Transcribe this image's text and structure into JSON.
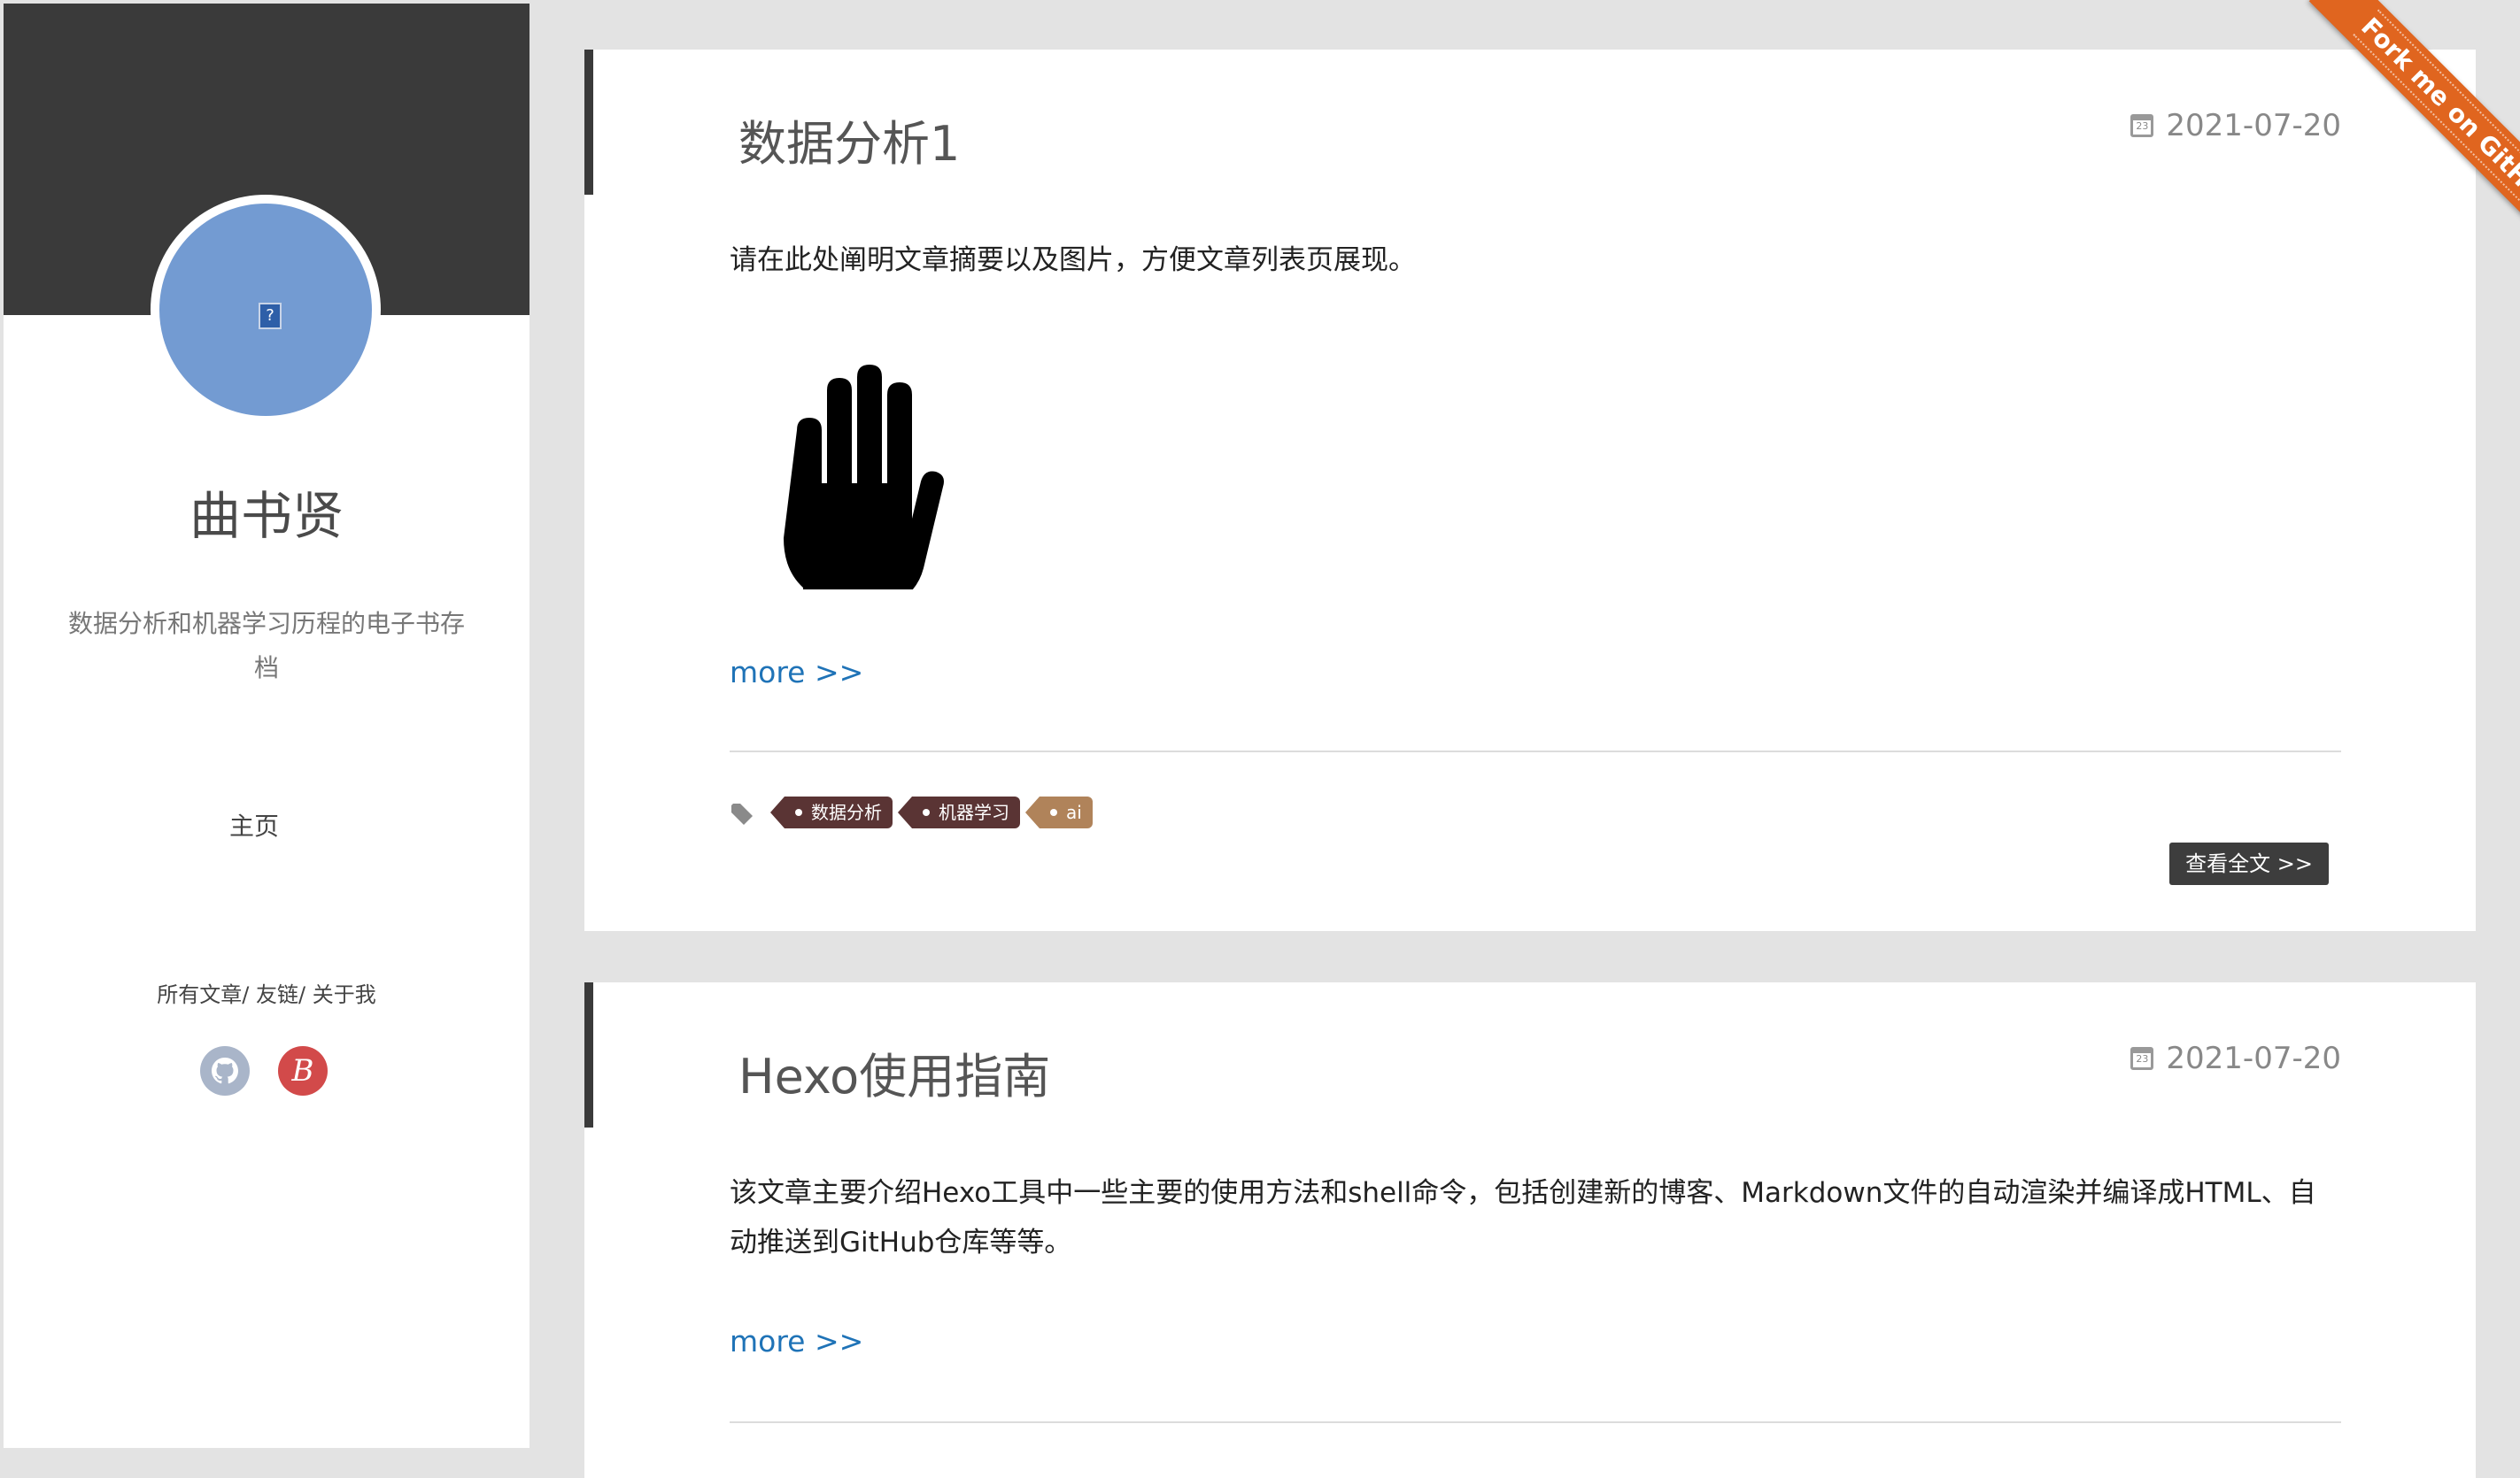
{
  "sidebar": {
    "author_name": "曲书贤",
    "description": "数据分析和机器学习历程的电子书存档",
    "nav_home": "主页",
    "links": [
      "所有文章",
      "友链",
      "关于我"
    ],
    "link_separator": "/",
    "blog_icon_letter": "B",
    "broken_image_glyph": "?"
  },
  "ribbon": {
    "label": "Fork me on GitHub"
  },
  "posts": [
    {
      "title": "数据分析1",
      "date": "2021-07-20",
      "date_icon_number": "23",
      "excerpt": "请在此处阐明文章摘要以及图片，方便文章列表页展现。",
      "more": "more >>",
      "tags": [
        "数据分析",
        "机器学习",
        "ai"
      ],
      "read_more": "查看全文 >>"
    },
    {
      "title": "Hexo使用指南",
      "date": "2021-07-20",
      "date_icon_number": "23",
      "excerpt": "该文章主要介绍Hexo工具中一些主要的使用方法和shell命令，包括创建新的博客、Markdown文件的自动渲染并编译成HTML、自动推送到GitHub仓库等等。",
      "more": "more >>"
    }
  ]
}
